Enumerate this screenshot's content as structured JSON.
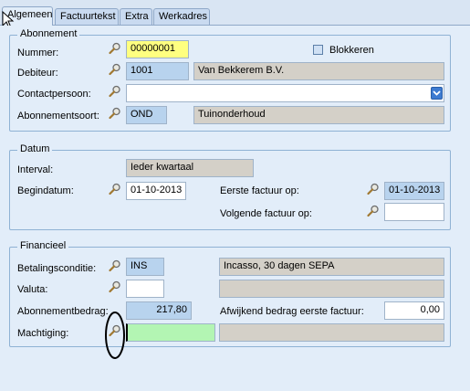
{
  "tabs": [
    {
      "label": "Algemeen"
    },
    {
      "label": "Factuurtekst"
    },
    {
      "label": "Extra"
    },
    {
      "label": "Werkadres"
    }
  ],
  "abonnement": {
    "title": "Abonnement",
    "nummer_label": "Nummer:",
    "nummer_value": "00000001",
    "blokkeren_label": "Blokkeren",
    "debiteur_label": "Debiteur:",
    "debiteur_code": "1001",
    "debiteur_name": "Van Bekkerem B.V.",
    "contactpersoon_label": "Contactpersoon:",
    "contactpersoon_value": "",
    "abonnementsoort_label": "Abonnementsoort:",
    "abonnementsoort_code": "OND",
    "abonnementsoort_desc": "Tuinonderhoud"
  },
  "datum": {
    "title": "Datum",
    "interval_label": "Interval:",
    "interval_value": "Ieder kwartaal",
    "begindatum_label": "Begindatum:",
    "begindatum_value": "01-10-2013",
    "eerste_factuur_label": "Eerste factuur op:",
    "eerste_factuur_value": "01-10-2013",
    "volgende_factuur_label": "Volgende factuur op:",
    "volgende_factuur_value": ""
  },
  "financieel": {
    "title": "Financieel",
    "betalingsconditie_label": "Betalingsconditie:",
    "betalingsconditie_code": "INS",
    "betalingsconditie_desc": "Incasso, 30 dagen SEPA",
    "valuta_label": "Valuta:",
    "valuta_value": "",
    "valuta_desc": "",
    "abonnementbedrag_label": "Abonnementbedrag:",
    "abonnementbedrag_value": "217,80",
    "afwijkend_label": "Afwijkend bedrag eerste factuur:",
    "afwijkend_value": "0,00",
    "machtiging_label": "Machtiging:",
    "machtiging_value": "",
    "machtiging_desc": ""
  },
  "icons": {
    "lookup": "magnifier-icon",
    "dropdown": "chevron-down-icon",
    "cursor": "mouse-pointer-icon"
  },
  "colors": {
    "required": "#ffff80",
    "active_input": "#b3f5b3",
    "readonly": "#d4d0c8",
    "code_field": "#b8d3ee"
  }
}
